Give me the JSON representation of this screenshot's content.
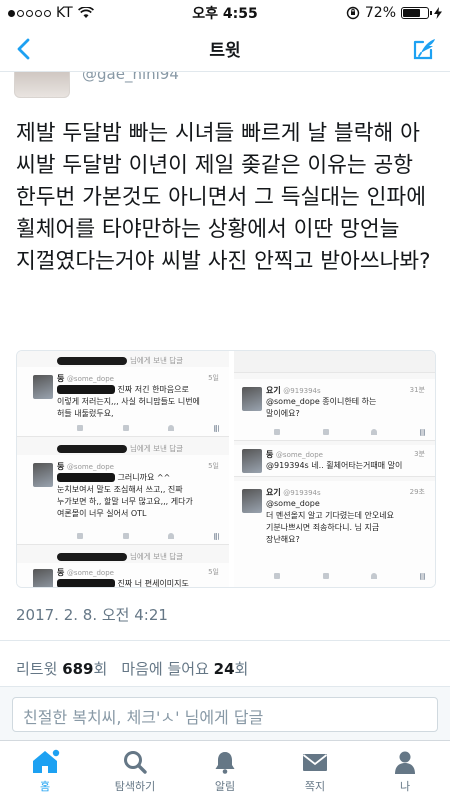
{
  "status_bar": {
    "carrier": "KT",
    "time": "오후 4:55",
    "battery": "72%",
    "battery_level": 0.72,
    "signal_bars_on": 1,
    "signal_bars_total": 5
  },
  "nav": {
    "title": "트윗",
    "back_icon": "chevron-left-icon",
    "compose_icon": "compose-tweet-icon",
    "accent_color": "#1da1f2"
  },
  "author": {
    "handle": "@gae_nini94"
  },
  "tweet": {
    "text": "제발 두달밤 빠는 시녀들 빠르게 날 블락해 아 씨발 두달밤 이년이 제일 좆같은 이유는 공항 한두번 가본것도 아니면서 그 득실대는 인파에 휠체어를 타야만하는 상황에서 이딴 망언늘 지껄였다는거야 씨발 사진 안찍고 받아쓰나봐?",
    "timestamp": "2017. 2. 8. 오전 4:21"
  },
  "media": {
    "left": {
      "reply_suffix": "님에게 보낸 답글",
      "tweets": [
        {
          "name": "둥",
          "handle": "@some_dope",
          "time": "5일",
          "body": "진짜 저긴 한마음으로\n이렇게 저러는지,,, 사실 허니맘들도 니번에\n허들 내둘렀두요,"
        },
        {
          "name": "둥",
          "handle": "@some_dope",
          "time": "5일",
          "body": "그러니까요 ^^\n눈치보여서 말도 조심해서 쓰고,, 진짜\n누가보면 하,, 할말 너무 많고요,,, 게다가\n여론몰이 너무 실어서 OTL"
        },
        {
          "name": "둥",
          "handle": "@some_dope",
          "time": "5일",
          "body": "진짜 너 편세이미지도"
        }
      ]
    },
    "right": {
      "tweets": [
        {
          "name": "요기",
          "handle": "@919394s",
          "time": "31분",
          "body": "@some_dope 종이니한테 하는\n말이에요?"
        },
        {
          "name": "둥",
          "handle": "@some_dope",
          "time": "3분",
          "body": "@919394s 네.. 휠체어타는거때매 말이"
        },
        {
          "name": "요기",
          "handle": "@919394s",
          "time": "29초",
          "body": "@some_dope\n더 멘션올지 알고 기다렸는데 안오네요\n기분나쁘시면 죄송하다니. 님 지금\n장난해요?"
        }
      ]
    }
  },
  "stats": {
    "retweets_label": "리트윗",
    "retweets_count": "689",
    "retweets_unit": "회",
    "likes_label": "마음에 들어요",
    "likes_count": "24",
    "likes_unit": "회"
  },
  "reply": {
    "placeholder": "친절한 복치씨, 체크'ㅅ' 님에게 답글"
  },
  "tabs": [
    {
      "label": "홈",
      "icon": "home-icon",
      "active": true
    },
    {
      "label": "탐색하기",
      "icon": "search-icon",
      "active": false
    },
    {
      "label": "알림",
      "icon": "bell-icon",
      "active": false
    },
    {
      "label": "쪽지",
      "icon": "envelope-icon",
      "active": false
    },
    {
      "label": "나",
      "icon": "person-icon",
      "active": false
    }
  ]
}
